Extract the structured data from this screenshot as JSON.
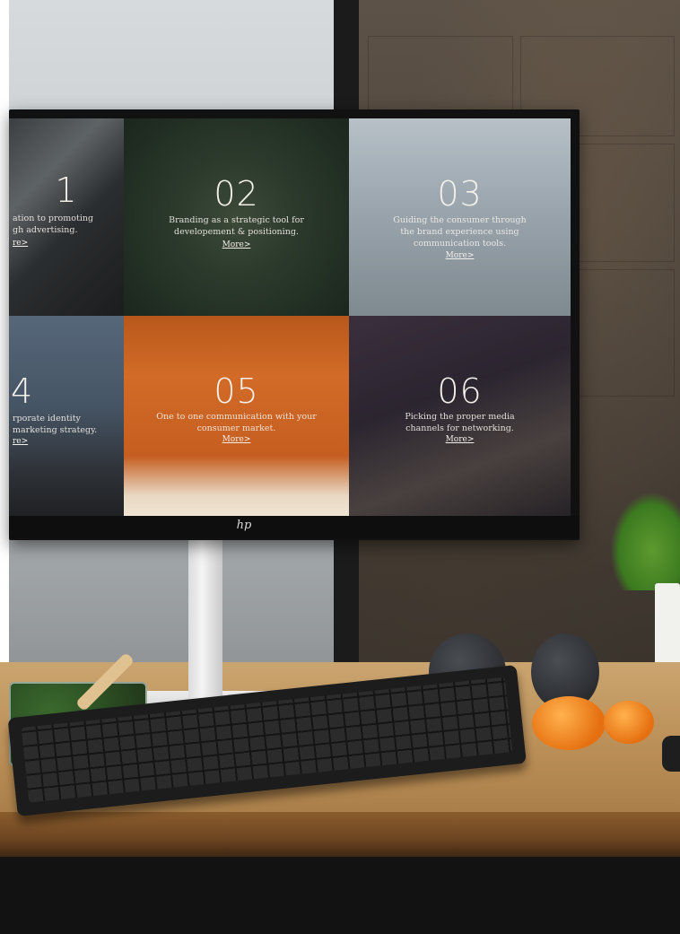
{
  "screen": {
    "tiles": [
      {
        "number": "1",
        "text": "ation to promoting\ngh advertising.",
        "more": "re>"
      },
      {
        "number": "02",
        "text": "Branding as a strategic tool for\ndevelopement & positioning.",
        "more": "More>"
      },
      {
        "number": "03",
        "text": "Guiding the consumer through\nthe brand experience using\ncommunication tools.",
        "more": "More>"
      },
      {
        "number": "4",
        "text": "rporate identity\nmarketing strategy.",
        "more": "re>"
      },
      {
        "number": "05",
        "text": "One to one communication with your\nconsumer market.",
        "more": "More>"
      },
      {
        "number": "06",
        "text": "Picking the proper media\nchannels for networking.",
        "more": "More>"
      }
    ],
    "brand_logo": "hp"
  }
}
